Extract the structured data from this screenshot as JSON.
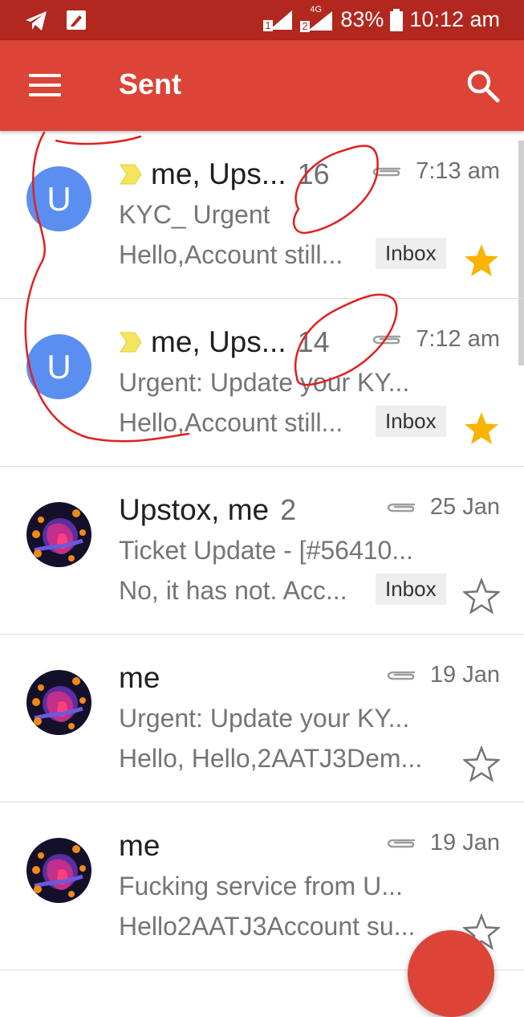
{
  "status_bar": {
    "sim1": "1",
    "sim2": "2",
    "network": "4G",
    "battery": "83%",
    "time": "10:12 am"
  },
  "app_bar": {
    "title": "Sent"
  },
  "emails": [
    {
      "avatar_letter": "U",
      "important": true,
      "sender": "me, Ups...",
      "count": "16",
      "has_attachment": true,
      "date": "7:13 am",
      "subject": "KYC_ Urgent",
      "snippet": "Hello,Account still...",
      "label": "Inbox",
      "starred": true
    },
    {
      "avatar_letter": "U",
      "important": true,
      "sender": "me, Ups...",
      "count": "14",
      "has_attachment": true,
      "date": "7:12 am",
      "subject": "Urgent: Update your KY...",
      "snippet": "Hello,Account still...",
      "label": "Inbox",
      "starred": true
    },
    {
      "avatar_letter": "",
      "important": false,
      "sender": "Upstox, me",
      "count": "2",
      "has_attachment": true,
      "date": "25 Jan",
      "subject": "Ticket Update - [#56410...",
      "snippet": "No, it has not. Acc...",
      "label": "Inbox",
      "starred": false
    },
    {
      "avatar_letter": "",
      "important": false,
      "sender": "me",
      "count": "",
      "has_attachment": true,
      "date": "19 Jan",
      "subject": "Urgent: Update your KY...",
      "snippet": "Hello, Hello,2AATJ3Dem...",
      "label": "",
      "starred": false
    },
    {
      "avatar_letter": "",
      "important": false,
      "sender": "me",
      "count": "",
      "has_attachment": true,
      "date": "19 Jan",
      "subject": "Fucking service from U...",
      "snippet": "Hello2AATJ3Account su...",
      "label": "",
      "starred": false
    }
  ],
  "colors": {
    "status_bar": "#b2271e",
    "app_bar": "#db4437",
    "avatar_blue": "#5a8ef0",
    "star_gold": "#f9b400",
    "important_yellow": "#f4e55b",
    "annotation_red": "#e02020"
  }
}
